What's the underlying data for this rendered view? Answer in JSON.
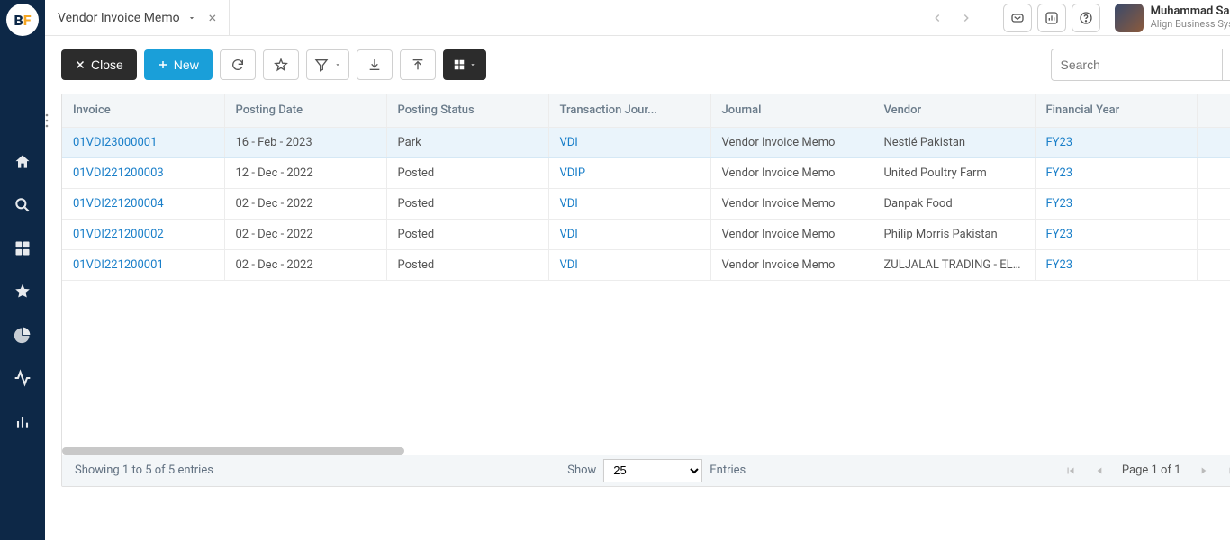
{
  "header": {
    "tab_title": "Vendor Invoice Memo",
    "user_name": "Muhammad Sadiq",
    "user_org": "Align Business Systems"
  },
  "toolbar": {
    "close_label": "Close",
    "new_label": "New",
    "search_placeholder": "Search"
  },
  "table": {
    "columns": {
      "invoice": "Invoice",
      "posting_date": "Posting Date",
      "posting_status": "Posting Status",
      "txn_journal": "Transaction Jour...",
      "journal": "Journal",
      "vendor": "Vendor",
      "financial_year": "Financial Year"
    },
    "rows": [
      {
        "invoice": "01VDI23000001",
        "date": "16 - Feb - 2023",
        "status": "Park",
        "txn": "VDI",
        "journal": "Vendor Invoice Memo",
        "vendor": "Nestlé Pakistan",
        "fy": "FY23"
      },
      {
        "invoice": "01VDI221200003",
        "date": "12 - Dec - 2022",
        "status": "Posted",
        "txn": "VDIP",
        "journal": "Vendor Invoice Memo",
        "vendor": "United Poultry Farm",
        "fy": "FY23"
      },
      {
        "invoice": "01VDI221200004",
        "date": "02 - Dec - 2022",
        "status": "Posted",
        "txn": "VDI",
        "journal": "Vendor Invoice Memo",
        "vendor": "Danpak Food",
        "fy": "FY23"
      },
      {
        "invoice": "01VDI221200002",
        "date": "02 - Dec - 2022",
        "status": "Posted",
        "txn": "VDI",
        "journal": "Vendor Invoice Memo",
        "vendor": "Philip Morris Pakistan",
        "fy": "FY23"
      },
      {
        "invoice": "01VDI221200001",
        "date": "02 - Dec - 2022",
        "status": "Posted",
        "txn": "VDI",
        "journal": "Vendor Invoice Memo",
        "vendor": "ZULJALAL TRADING - ELECTR...",
        "fy": "FY23"
      }
    ]
  },
  "footer": {
    "showing_text": "Showing 1 to 5 of 5 entries",
    "show_label": "Show",
    "entries_label": "Entries",
    "page_size": "25",
    "page_text": "Page 1 of 1"
  }
}
